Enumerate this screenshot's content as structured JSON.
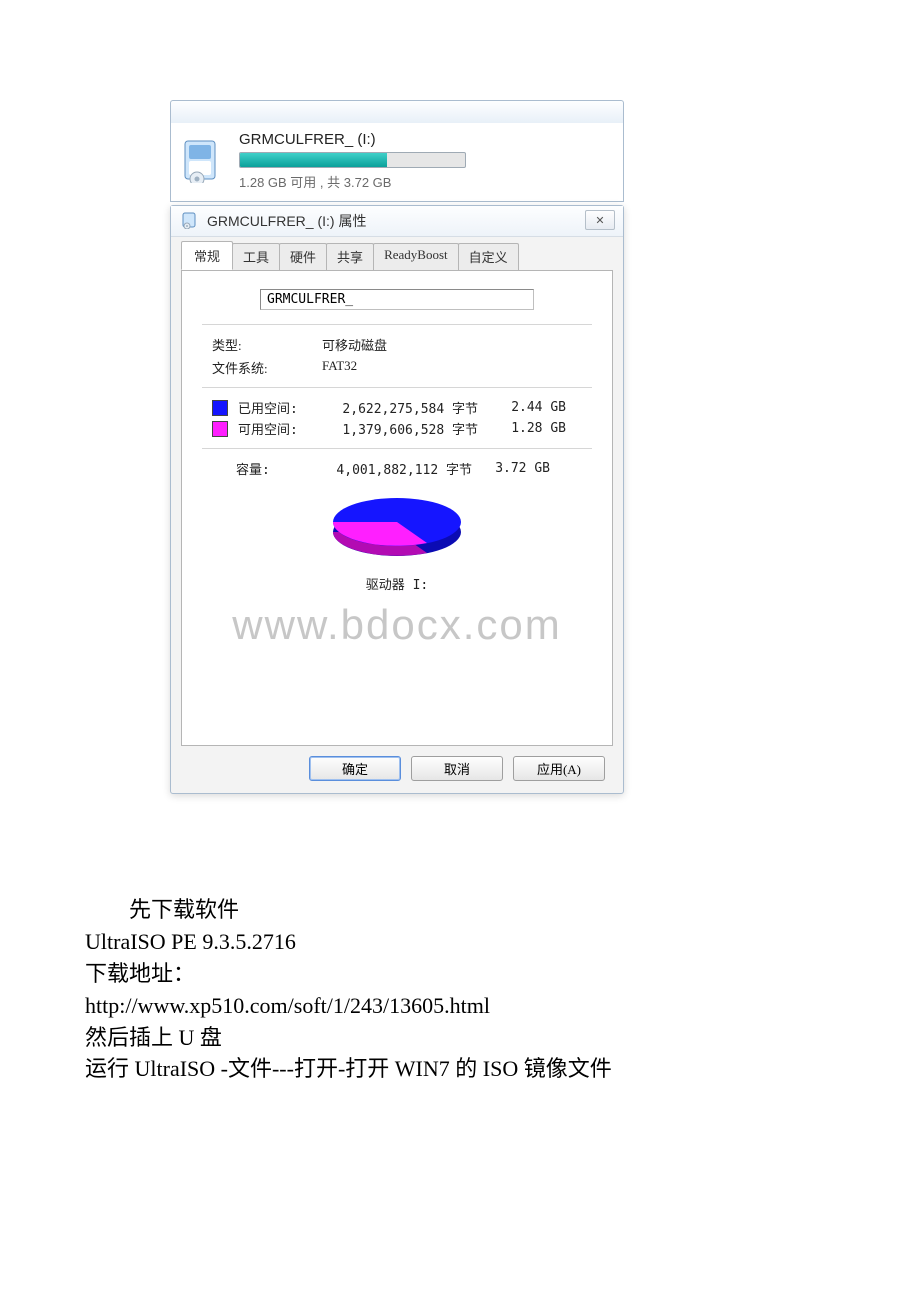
{
  "drive_header": {
    "name": "GRMCULFRER_ (I:)",
    "subtitle": "1.28 GB 可用 , 共 3.72 GB"
  },
  "props": {
    "title": "GRMCULFRER_ (I:) 属性",
    "close_glyph": "✕",
    "tabs": {
      "general": "常规",
      "tools": "工具",
      "hardware": "硬件",
      "sharing": "共享",
      "readyboost": "ReadyBoost",
      "custom": "自定义"
    },
    "volume_name": "GRMCULFRER_",
    "type_label": "类型:",
    "type_value": "可移动磁盘",
    "fs_label": "文件系统:",
    "fs_value": "FAT32",
    "used_label": "已用空间:",
    "used_bytes": "2,622,275,584 字节",
    "used_gb": "2.44 GB",
    "free_label": "可用空间:",
    "free_bytes": "1,379,606,528 字节",
    "free_gb": "1.28 GB",
    "cap_label": "容量:",
    "cap_bytes": "4,001,882,112 字节",
    "cap_gb": "3.72 GB",
    "drive_label": "驱动器 I:",
    "watermark": "www.bdocx.com",
    "buttons": {
      "ok": "确定",
      "cancel": "取消",
      "apply": "应用(A)"
    }
  },
  "doc": {
    "l1": "先下载软件",
    "l2": "UltraISO PE 9.3.5.2716",
    "l3": "下载地址：",
    "l4": "http://www.xp510.com/soft/1/243/13605.html",
    "l5": "然后插上 U 盘",
    "l6": "运行 UltraISO  -文件---打开-打开 WIN7 的 ISO 镜像文件"
  },
  "chart_data": {
    "type": "pie",
    "title": "驱动器 I:",
    "series": [
      {
        "name": "已用空间",
        "value": 2622275584,
        "gb": 2.44,
        "color": "#1515ff"
      },
      {
        "name": "可用空间",
        "value": 1379606528,
        "gb": 1.28,
        "color": "#ff1fff"
      }
    ],
    "total": {
      "bytes": 4001882112,
      "gb": 3.72
    }
  }
}
